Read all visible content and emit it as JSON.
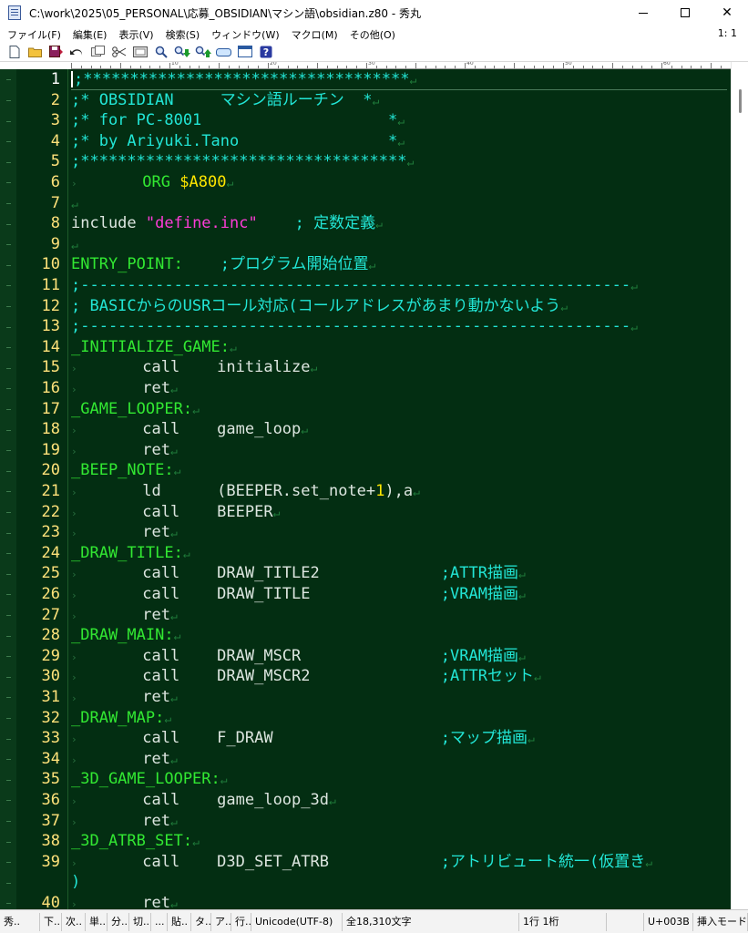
{
  "window": {
    "title": "C:\\work\\2025\\05_PERSONAL\\応募_OBSIDIAN\\マシン語\\obsidian.z80 - 秀丸",
    "controls": {
      "minimize": "—",
      "maximize": "☐",
      "close": "✕"
    }
  },
  "menu": {
    "items": [
      "ファイル(F)",
      "編集(E)",
      "表示(V)",
      "検索(S)",
      "ウィンドウ(W)",
      "マクロ(M)",
      "その他(O)"
    ],
    "cursor_position": "1: 1"
  },
  "toolbar": {
    "icons": [
      "new-file-icon",
      "open-folder-icon",
      "save-icon",
      "undo-icon",
      "copy-icon",
      "cut-icon",
      "paste-icon",
      "find-icon",
      "find-down-icon",
      "find-up-icon",
      "replace-icon",
      "window-icon",
      "help-icon"
    ]
  },
  "ruler": {
    "labels": [
      "10",
      "20",
      "30",
      "40",
      "50",
      "60",
      "70"
    ]
  },
  "editor": {
    "colors": {
      "background": "#032e12",
      "line_number": "#ffe27a",
      "label": "#32e832",
      "comment": "#22e6d6",
      "string": "#ff3cd8",
      "number": "#ffe600",
      "text": "#dde6e0"
    },
    "return_mark": "↵",
    "tab_mark": "›",
    "lines": [
      {
        "n": "1",
        "parts": [
          {
            "t": "cmt",
            "v": ";***********************************"
          }
        ]
      },
      {
        "n": "2",
        "parts": [
          {
            "t": "cmt",
            "v": ";* OBSIDIAN     マシン語ルーチン  *"
          }
        ]
      },
      {
        "n": "3",
        "parts": [
          {
            "t": "cmt",
            "v": ";* for PC-8001                    *"
          }
        ]
      },
      {
        "n": "4",
        "parts": [
          {
            "t": "cmt",
            "v": ";* by Ariyuki.Tano                *"
          }
        ]
      },
      {
        "n": "5",
        "parts": [
          {
            "t": "cmt",
            "v": ";***********************************"
          }
        ]
      },
      {
        "n": "6",
        "parts": [
          {
            "t": "tab",
            "v": "        "
          },
          {
            "t": "lbl",
            "v": "ORG"
          },
          {
            "t": "txt",
            "v": " "
          },
          {
            "t": "num",
            "v": "$A800"
          }
        ]
      },
      {
        "n": "7",
        "parts": []
      },
      {
        "n": "8",
        "parts": [
          {
            "t": "txt",
            "v": "include "
          },
          {
            "t": "str",
            "v": "\"define.inc\""
          },
          {
            "t": "txt",
            "v": "    "
          },
          {
            "t": "cmt",
            "v": "; 定数定義"
          }
        ]
      },
      {
        "n": "9",
        "parts": []
      },
      {
        "n": "10",
        "parts": [
          {
            "t": "lbl",
            "v": "ENTRY_POINT:"
          },
          {
            "t": "txt",
            "v": "    "
          },
          {
            "t": "cmt",
            "v": ";プログラム開始位置"
          }
        ]
      },
      {
        "n": "11",
        "parts": [
          {
            "t": "cmt",
            "v": ";-----------------------------------------------------------"
          }
        ]
      },
      {
        "n": "12",
        "parts": [
          {
            "t": "cmt",
            "v": "; BASICからのUSRコール対応(コールアドレスがあまり動かないよう"
          }
        ]
      },
      {
        "n": "13",
        "parts": [
          {
            "t": "cmt",
            "v": ";-----------------------------------------------------------"
          }
        ]
      },
      {
        "n": "14",
        "parts": [
          {
            "t": "lbl",
            "v": "_INITIALIZE_GAME:"
          }
        ]
      },
      {
        "n": "15",
        "parts": [
          {
            "t": "tab",
            "v": "        "
          },
          {
            "t": "txt",
            "v": "call    initialize"
          }
        ]
      },
      {
        "n": "16",
        "parts": [
          {
            "t": "tab",
            "v": "        "
          },
          {
            "t": "txt",
            "v": "ret"
          }
        ]
      },
      {
        "n": "17",
        "parts": [
          {
            "t": "lbl",
            "v": "_GAME_LOOPER:"
          }
        ]
      },
      {
        "n": "18",
        "parts": [
          {
            "t": "tab",
            "v": "        "
          },
          {
            "t": "txt",
            "v": "call    game_loop"
          }
        ]
      },
      {
        "n": "19",
        "parts": [
          {
            "t": "tab",
            "v": "        "
          },
          {
            "t": "txt",
            "v": "ret"
          }
        ]
      },
      {
        "n": "20",
        "parts": [
          {
            "t": "lbl",
            "v": "_BEEP_NOTE:"
          }
        ]
      },
      {
        "n": "21",
        "parts": [
          {
            "t": "tab",
            "v": "        "
          },
          {
            "t": "txt",
            "v": "ld      (BEEPER.set_note+"
          },
          {
            "t": "num",
            "v": "1"
          },
          {
            "t": "txt",
            "v": "),a"
          }
        ]
      },
      {
        "n": "22",
        "parts": [
          {
            "t": "tab",
            "v": "        "
          },
          {
            "t": "txt",
            "v": "call    BEEPER"
          }
        ]
      },
      {
        "n": "23",
        "parts": [
          {
            "t": "tab",
            "v": "        "
          },
          {
            "t": "txt",
            "v": "ret"
          }
        ]
      },
      {
        "n": "24",
        "parts": [
          {
            "t": "lbl",
            "v": "_DRAW_TITLE:"
          }
        ]
      },
      {
        "n": "25",
        "parts": [
          {
            "t": "tab",
            "v": "        "
          },
          {
            "t": "txt",
            "v": "call    DRAW_TITLE2             "
          },
          {
            "t": "cmt",
            "v": ";ATTR描画"
          }
        ]
      },
      {
        "n": "26",
        "parts": [
          {
            "t": "tab",
            "v": "        "
          },
          {
            "t": "txt",
            "v": "call    DRAW_TITLE              "
          },
          {
            "t": "cmt",
            "v": ";VRAM描画"
          }
        ]
      },
      {
        "n": "27",
        "parts": [
          {
            "t": "tab",
            "v": "        "
          },
          {
            "t": "txt",
            "v": "ret"
          }
        ]
      },
      {
        "n": "28",
        "parts": [
          {
            "t": "lbl",
            "v": "_DRAW_MAIN:"
          }
        ]
      },
      {
        "n": "29",
        "parts": [
          {
            "t": "tab",
            "v": "        "
          },
          {
            "t": "txt",
            "v": "call    DRAW_MSCR               "
          },
          {
            "t": "cmt",
            "v": ";VRAM描画"
          }
        ]
      },
      {
        "n": "30",
        "parts": [
          {
            "t": "tab",
            "v": "        "
          },
          {
            "t": "txt",
            "v": "call    DRAW_MSCR2              "
          },
          {
            "t": "cmt",
            "v": ";ATTRセット"
          }
        ]
      },
      {
        "n": "31",
        "parts": [
          {
            "t": "tab",
            "v": "        "
          },
          {
            "t": "txt",
            "v": "ret"
          }
        ]
      },
      {
        "n": "32",
        "parts": [
          {
            "t": "lbl",
            "v": "_DRAW_MAP:"
          }
        ]
      },
      {
        "n": "33",
        "parts": [
          {
            "t": "tab",
            "v": "        "
          },
          {
            "t": "txt",
            "v": "call    F_DRAW                  "
          },
          {
            "t": "cmt",
            "v": ";マップ描画"
          }
        ]
      },
      {
        "n": "34",
        "parts": [
          {
            "t": "tab",
            "v": "        "
          },
          {
            "t": "txt",
            "v": "ret"
          }
        ]
      },
      {
        "n": "35",
        "parts": [
          {
            "t": "lbl",
            "v": "_3D_GAME_LOOPER:"
          }
        ]
      },
      {
        "n": "36",
        "parts": [
          {
            "t": "tab",
            "v": "        "
          },
          {
            "t": "txt",
            "v": "call    game_loop_3d"
          }
        ]
      },
      {
        "n": "37",
        "parts": [
          {
            "t": "tab",
            "v": "        "
          },
          {
            "t": "txt",
            "v": "ret"
          }
        ]
      },
      {
        "n": "38",
        "parts": [
          {
            "t": "lbl",
            "v": "_3D_ATRB_SET:"
          }
        ]
      },
      {
        "n": "39",
        "parts": [
          {
            "t": "tab",
            "v": "        "
          },
          {
            "t": "txt",
            "v": "call    D3D_SET_ATRB            "
          },
          {
            "t": "cmt",
            "v": ";アトリビュート統一(仮置き"
          }
        ]
      },
      {
        "n": "",
        "parts": [
          {
            "t": "cmt",
            "v": ")"
          }
        ]
      },
      {
        "n": "40",
        "parts": [
          {
            "t": "tab",
            "v": "        "
          },
          {
            "t": "txt",
            "v": "ret"
          }
        ]
      }
    ]
  },
  "statusbar": {
    "cells": [
      "秀..",
      "下..",
      "次..",
      "単..",
      "分..",
      "切..",
      "...",
      "貼..",
      "タ..",
      "ア..",
      "行..",
      "Unicode(UTF-8)",
      "全18,310文字",
      "1行 1桁",
      "",
      "U+003B",
      "挿入モード"
    ]
  }
}
